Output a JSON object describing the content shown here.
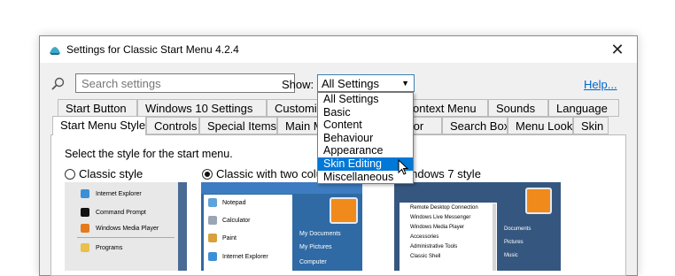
{
  "window": {
    "title": "Settings for Classic Start Menu 4.2.4",
    "close_glyph": "✕"
  },
  "search": {
    "placeholder": "Search settings"
  },
  "show": {
    "label": "Show:",
    "value": "All Settings"
  },
  "help_link": "Help...",
  "tabs_row1": [
    "Start Button",
    "Windows 10 Settings",
    "Customiz",
    "ontext Menu",
    "Sounds",
    "Language"
  ],
  "tabs_row2": [
    "Start Menu Style",
    "Controls",
    "Special Items",
    "Main M",
    "avior",
    "Search Box",
    "Menu Look",
    "Skin"
  ],
  "instruction": "Select the style for the start menu.",
  "styles": [
    {
      "label": "Classic style",
      "selected": false
    },
    {
      "label": "Classic with two colu",
      "selected": true
    },
    {
      "label": "Windows 7 style",
      "selected": false
    }
  ],
  "dropdown": {
    "options": [
      "All Settings",
      "Basic",
      "Content",
      "Behaviour",
      "Appearance",
      "Skin Editing",
      "Miscellaneous"
    ],
    "highlighted_index": 5
  },
  "previews": {
    "classic": [
      "Internet Explorer",
      "Command Prompt",
      "Windows Media Player",
      "Programs"
    ],
    "two_col_left": [
      "Notepad",
      "Calculator",
      "Paint",
      "Internet Explorer"
    ],
    "two_col_right": [
      "My Documents",
      "My Pictures",
      "Computer"
    ],
    "win7_left": [
      "Remote Desktop Connection",
      "Windows Live Messenger",
      "Windows Media Player",
      "Accessories",
      "Administrative Tools",
      "Classic Shell"
    ],
    "win7_right": [
      "Documents",
      "Pictures",
      "Music"
    ]
  },
  "colors": {
    "accent": "#0078d7",
    "link": "#0066cc",
    "preview_blue": "#2a6fa8",
    "preview_dark": "#3d5d86"
  }
}
